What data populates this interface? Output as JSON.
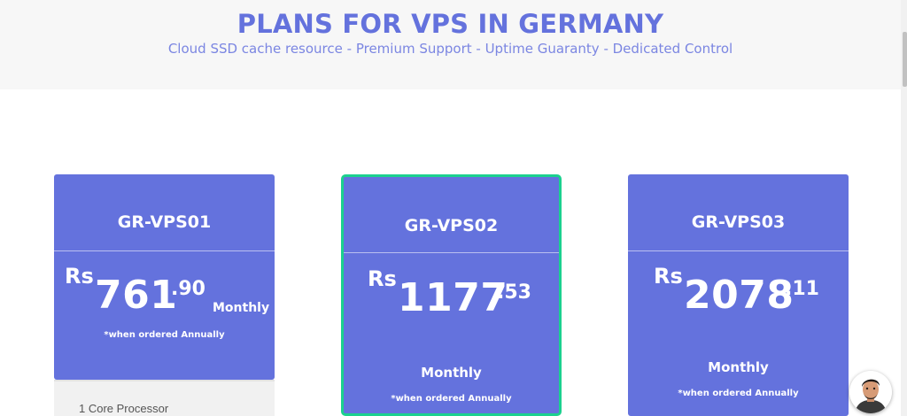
{
  "header": {
    "title": "PLANS FOR VPS IN GERMANY",
    "subtitle": "Cloud SSD cache resource - Premium Support - Uptime Guaranty - Dedicated Control"
  },
  "plans": [
    {
      "name": "GR-VPS01",
      "currency": "Rs",
      "amount": "761",
      "cents": ".90",
      "period": "Monthly",
      "note": "*when ordered Annually",
      "features": [
        "1 Core Processor"
      ]
    },
    {
      "name": "GR-VPS02",
      "currency": "Rs",
      "amount": "1177",
      "cents": ".53",
      "period": "Monthly",
      "note": "*when ordered Annually",
      "featured": true
    },
    {
      "name": "GR-VPS03",
      "currency": "Rs",
      "amount": "2078",
      "cents": ".11",
      "period": "Monthly",
      "note": "*when ordered Annually"
    }
  ],
  "chat_widget": {
    "icon": "support-agent-avatar-icon"
  },
  "colors": {
    "accent": "#6472dd",
    "featured_border": "#1bd18e",
    "header_band": "#f7f7f7"
  }
}
